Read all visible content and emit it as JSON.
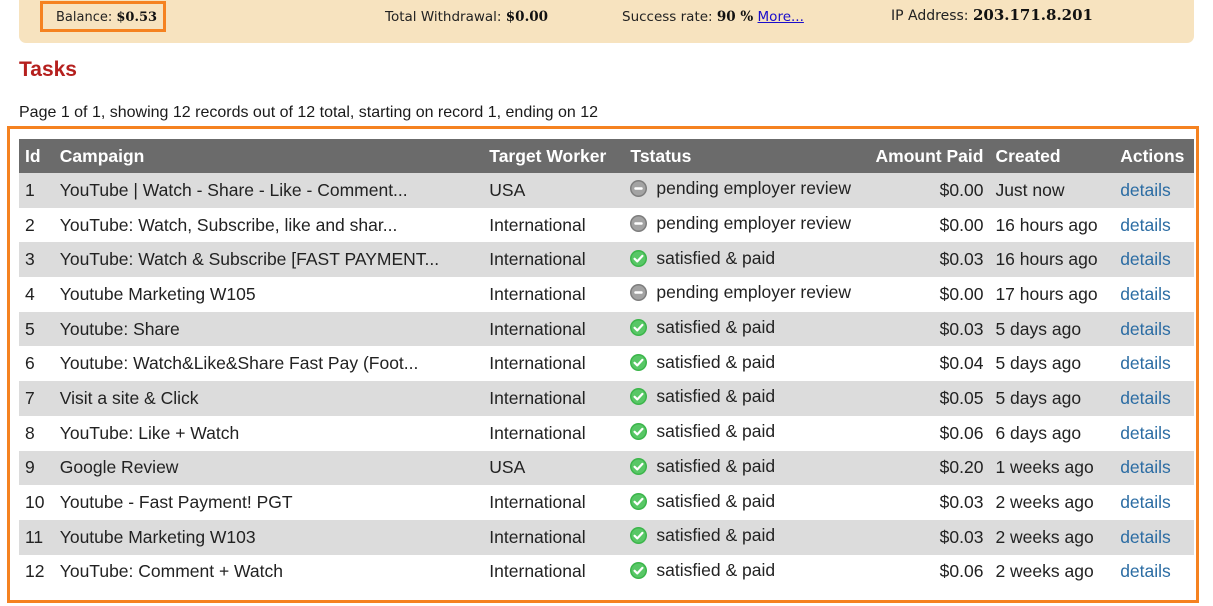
{
  "stats": {
    "balance_label": "Balance:",
    "balance_value": "$0.53",
    "withdrawal_label": "Total Withdrawal:",
    "withdrawal_value": "$0.00",
    "success_label": "Success rate:",
    "success_value": "90 %",
    "success_more": "More...",
    "ip_label": "IP Address:",
    "ip_value": "203.171.8.201"
  },
  "title": "Tasks",
  "summary": "Page 1 of 1, showing 12 records out of 12 total, starting on record 1, ending on 12",
  "table": {
    "headers": [
      "Id",
      "Campaign",
      "Target Worker",
      "Tstatus",
      "Amount Paid",
      "Created",
      "Actions"
    ],
    "rows": [
      {
        "id": "1",
        "campaign": "YouTube | Watch - Share - Like - Comment...",
        "target": "USA",
        "status": "pending employer review",
        "status_kind": "pending",
        "amount": "$0.00",
        "created": "Just now",
        "action": "details"
      },
      {
        "id": "2",
        "campaign": "YouTube: Watch, Subscribe, like and shar...",
        "target": "International",
        "status": "pending employer review",
        "status_kind": "pending",
        "amount": "$0.00",
        "created": "16 hours ago",
        "action": "details"
      },
      {
        "id": "3",
        "campaign": "YouTube: Watch & Subscribe [FAST PAYMENT...",
        "target": "International",
        "status": "satisfied & paid",
        "status_kind": "paid",
        "amount": "$0.03",
        "created": "16 hours ago",
        "action": "details"
      },
      {
        "id": "4",
        "campaign": "Youtube Marketing W105",
        "target": "International",
        "status": "pending employer review",
        "status_kind": "pending",
        "amount": "$0.00",
        "created": "17 hours ago",
        "action": "details"
      },
      {
        "id": "5",
        "campaign": "Youtube: Share",
        "target": "International",
        "status": "satisfied & paid",
        "status_kind": "paid",
        "amount": "$0.03",
        "created": "5 days ago",
        "action": "details"
      },
      {
        "id": "6",
        "campaign": "Youtube: Watch&Like&Share Fast Pay (Foot...",
        "target": "International",
        "status": "satisfied & paid",
        "status_kind": "paid",
        "amount": "$0.04",
        "created": "5 days ago",
        "action": "details"
      },
      {
        "id": "7",
        "campaign": "Visit a site & Click",
        "target": "International",
        "status": "satisfied & paid",
        "status_kind": "paid",
        "amount": "$0.05",
        "created": "5 days ago",
        "action": "details"
      },
      {
        "id": "8",
        "campaign": "YouTube: Like + Watch",
        "target": "International",
        "status": "satisfied & paid",
        "status_kind": "paid",
        "amount": "$0.06",
        "created": "6 days ago",
        "action": "details"
      },
      {
        "id": "9",
        "campaign": "Google Review",
        "target": "USA",
        "status": "satisfied & paid",
        "status_kind": "paid",
        "amount": "$0.20",
        "created": "1 weeks ago",
        "action": "details"
      },
      {
        "id": "10",
        "campaign": "Youtube - Fast Payment! PGT",
        "target": "International",
        "status": "satisfied & paid",
        "status_kind": "paid",
        "amount": "$0.03",
        "created": "2 weeks ago",
        "action": "details"
      },
      {
        "id": "11",
        "campaign": "Youtube Marketing W103",
        "target": "International",
        "status": "satisfied & paid",
        "status_kind": "paid",
        "amount": "$0.03",
        "created": "2 weeks ago",
        "action": "details"
      },
      {
        "id": "12",
        "campaign": "YouTube: Comment + Watch",
        "target": "International",
        "status": "satisfied & paid",
        "status_kind": "paid",
        "amount": "$0.06",
        "created": "2 weeks ago",
        "action": "details"
      }
    ]
  },
  "icons": {
    "pending": "minus-circle-icon",
    "paid": "check-circle-icon"
  },
  "colors": {
    "panel_bg": "#f7e3bf",
    "highlight": "#f58220",
    "title": "#b5201e",
    "header_bg": "#6b6b6b",
    "row_alt": "#dcdcdc",
    "link": "#2b6ca3",
    "paid_green": "#3bb54a",
    "pending_gray": "#8a8a8a"
  }
}
